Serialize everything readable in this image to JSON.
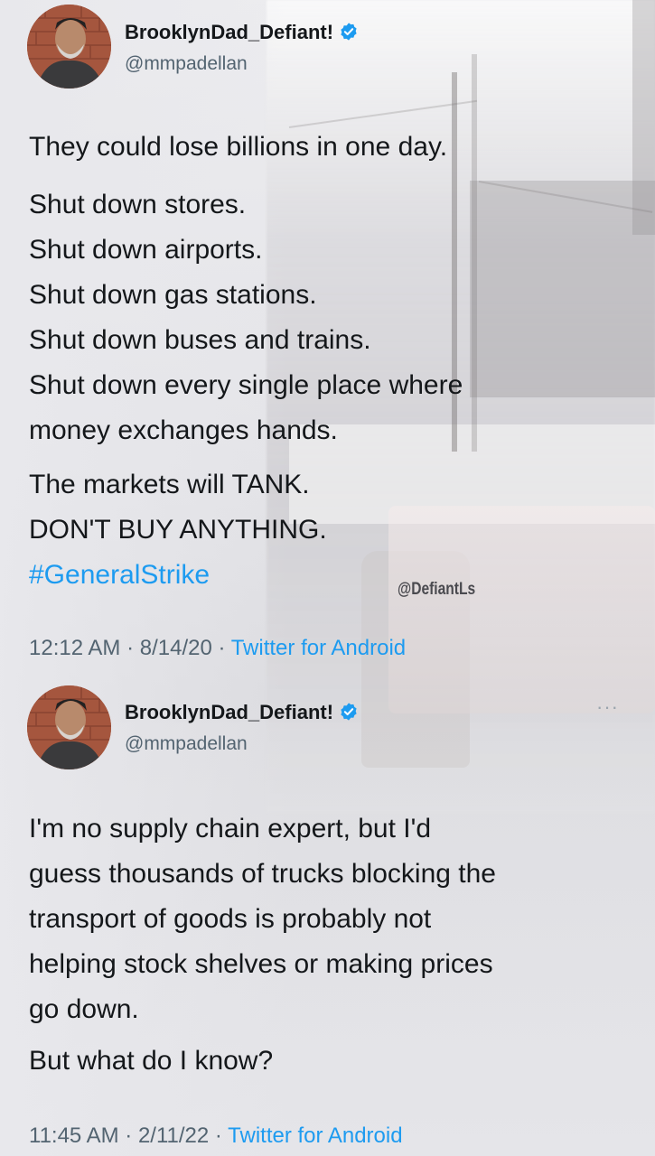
{
  "tweets": [
    {
      "display_name": "BrooklynDad_Defiant!",
      "handle": "@mmpadellan",
      "lines_intro": [
        "They could lose billions in one day."
      ],
      "lines_list": [
        "Shut down stores.",
        "Shut down airports.",
        "Shut down gas stations.",
        "Shut down buses and trains.",
        "Shut down every single place where",
        "money exchanges hands."
      ],
      "lines_end": [
        "The markets will TANK.",
        "DON'T BUY ANYTHING."
      ],
      "hashtag": "#GeneralStrike",
      "time": "12:12 AM",
      "date": "8/14/20",
      "source": "Twitter for Android"
    },
    {
      "display_name": "BrooklynDad_Defiant!",
      "handle": "@mmpadellan",
      "more": "···",
      "para1": [
        "I'm no supply chain expert, but I'd",
        "guess thousands of trucks blocking the",
        "transport of goods is probably not",
        "helping stock shelves or making prices",
        "go down."
      ],
      "para2": [
        "But what do I know?"
      ],
      "time": "11:45 AM",
      "date": "2/11/22",
      "source": "Twitter for Android"
    }
  ],
  "watermark": "@DefiantLs",
  "separator": " · ",
  "colors": {
    "accent": "#1d9bf0",
    "text": "#14171a",
    "muted": "#536471"
  }
}
